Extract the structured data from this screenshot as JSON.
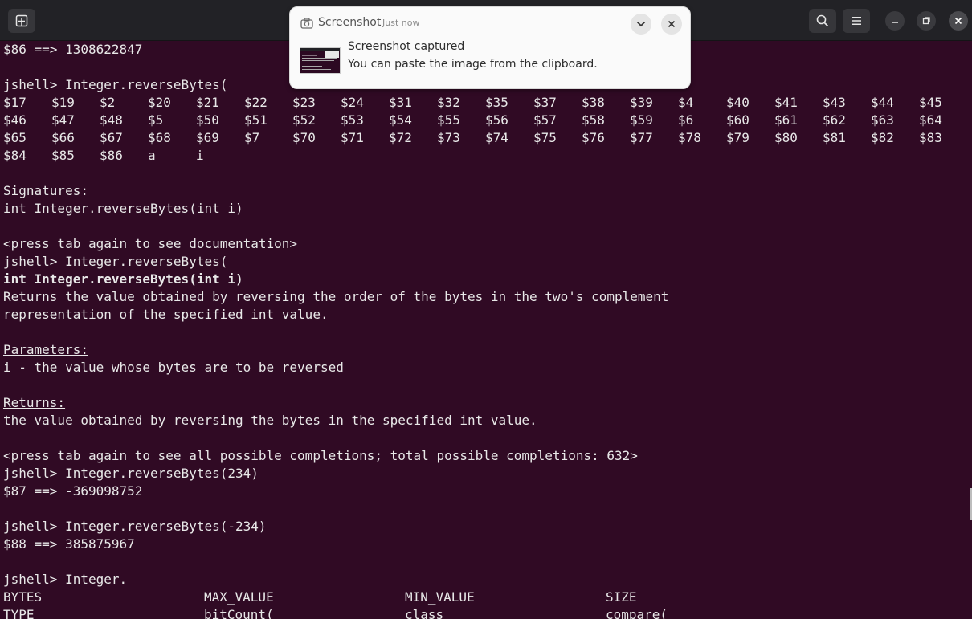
{
  "header": {
    "new_tab_icon": "new-tab-icon",
    "search_icon": "search-icon",
    "menu_icon": "hamburger-menu-icon",
    "minimize_icon": "minimize-icon",
    "restore_icon": "restore-icon",
    "close_icon": "close-icon"
  },
  "notification": {
    "app_name": "Screenshot",
    "time": "Just now",
    "title": "Screenshot captured",
    "body": "You can paste the image from the clipboard."
  },
  "terminal": {
    "l0": "$86 ==> 1308622847",
    "l2": "jshell> Integer.reverseBytes(",
    "grid": [
      [
        "$17",
        "$19",
        "$2",
        "$20",
        "$21",
        "$22",
        "$23",
        "$24",
        "$31",
        "$32",
        "$35",
        "$37",
        "$38",
        "$39",
        "$4",
        "$40",
        "$41",
        "$43",
        "$44",
        "$45"
      ],
      [
        "$46",
        "$47",
        "$48",
        "$5",
        "$50",
        "$51",
        "$52",
        "$53",
        "$54",
        "$55",
        "$56",
        "$57",
        "$58",
        "$59",
        "$6",
        "$60",
        "$61",
        "$62",
        "$63",
        "$64"
      ],
      [
        "$65",
        "$66",
        "$67",
        "$68",
        "$69",
        "$7",
        "$70",
        "$71",
        "$72",
        "$73",
        "$74",
        "$75",
        "$76",
        "$77",
        "$78",
        "$79",
        "$80",
        "$81",
        "$82",
        "$83"
      ],
      [
        "$84",
        "$85",
        "$86",
        "a",
        "i"
      ]
    ],
    "l9": "Signatures:",
    "l10": "int Integer.reverseBytes(int i)",
    "l12": "<press tab again to see documentation>",
    "l13": "jshell> Integer.reverseBytes(",
    "l14": "int Integer.reverseBytes(int i)",
    "l15": "Returns the value obtained by reversing the order of the bytes in the two's complement",
    "l16": "representation of the specified int value.",
    "l18": "Parameters:",
    "l19": "i - the value whose bytes are to be reversed",
    "l21": "Returns:",
    "l22": "the value obtained by reversing the bytes in the specified int value.",
    "l24": "<press tab again to see all possible completions; total possible completions: 632>",
    "l25": "jshell> Integer.reverseBytes(234)",
    "l26": "$87 ==> -369098752",
    "l28": "jshell> Integer.reverseBytes(-234)",
    "l29": "$88 ==> 385875967",
    "l31": "jshell> Integer.",
    "completions": [
      [
        "BYTES",
        "MAX_VALUE",
        "MIN_VALUE",
        "SIZE"
      ],
      [
        "TYPE",
        "bitCount(",
        "class",
        "compare("
      ]
    ]
  }
}
